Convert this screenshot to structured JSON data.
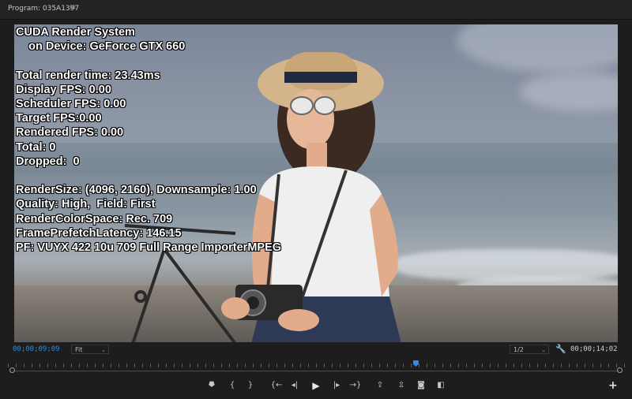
{
  "panel": {
    "title": "Program: 035A1397",
    "menu_glyph": "≡"
  },
  "overlay": {
    "lines": [
      "CUDA Render System",
      "    on Device: GeForce GTX 660",
      "",
      "Total render time: 23.43ms",
      "Display FPS: 0.00",
      "Scheduler FPS: 0.00",
      "Target FPS:0.00",
      "Rendered FPS: 0.00",
      "Total: 0",
      "Dropped:  0",
      "",
      "RenderSize: (4096, 2160), Downsample: 1.00",
      "Quality: High,  Field: First",
      "RenderColorSpace: Rec. 709",
      "FramePrefetchLatency: 146.15",
      "PF: VUYX 422 10u 709 Full Range ImporterMPEG"
    ]
  },
  "controls": {
    "current_timecode": "00;00;09;09",
    "zoom_value": "Fit",
    "resolution_value": "1/2",
    "duration_timecode": "00;00;14;02",
    "playhead_fraction": 0.67
  },
  "transport": [
    {
      "name": "add-marker-button",
      "icon": "marker-icon",
      "glyph": "⯂"
    },
    {
      "name": "mark-in-button",
      "icon": "mark-in-icon",
      "glyph": "{"
    },
    {
      "name": "mark-out-button",
      "icon": "mark-out-icon",
      "glyph": "}"
    },
    {
      "name": "go-to-in-button",
      "icon": "go-to-in-icon",
      "glyph": "{←"
    },
    {
      "name": "step-back-button",
      "icon": "step-back-icon",
      "glyph": "◂|"
    },
    {
      "name": "play-button",
      "icon": "play-icon",
      "glyph": "▶"
    },
    {
      "name": "step-forward-button",
      "icon": "step-forward-icon",
      "glyph": "|▸"
    },
    {
      "name": "go-to-out-button",
      "icon": "go-to-out-icon",
      "glyph": "→}"
    },
    {
      "name": "lift-button",
      "icon": "lift-icon",
      "glyph": "⇪"
    },
    {
      "name": "extract-button",
      "icon": "extract-icon",
      "glyph": "⇫"
    },
    {
      "name": "export-frame-button",
      "icon": "camera-icon",
      "glyph": "◙"
    },
    {
      "name": "comparison-view-button",
      "icon": "comparison-icon",
      "glyph": "◧"
    }
  ],
  "colors": {
    "accent": "#2d8ceb",
    "panel_bg": "#1d1d1d"
  }
}
